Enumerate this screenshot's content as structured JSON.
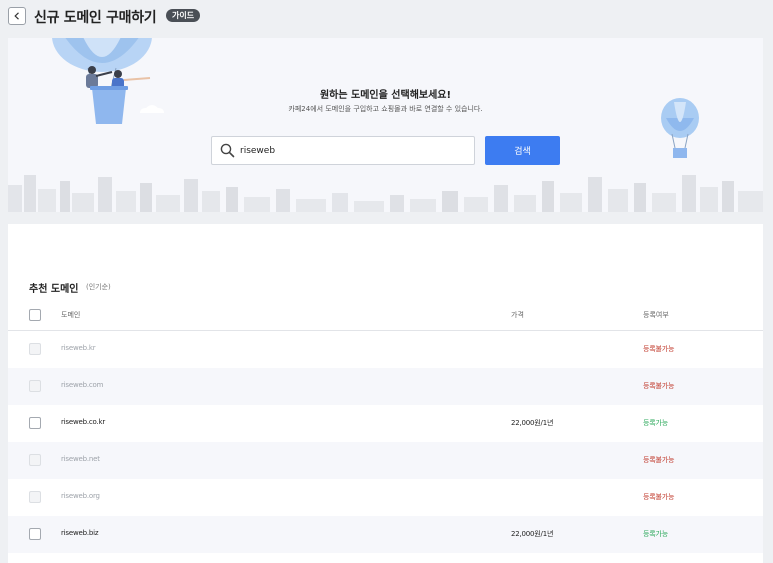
{
  "header": {
    "title": "신규 도메인 구매하기",
    "guide_badge": "가이드"
  },
  "hero": {
    "title": "원하는 도메인을 선택해보세요!",
    "subtitle": "카페24에서 도메인을 구입하고 쇼핑몰과 바로 연결할 수 있습니다.",
    "search": {
      "value": "riseweb",
      "placeholder": ""
    },
    "search_button": "검색"
  },
  "recommend": {
    "title": "추천 도메인",
    "subtitle": "(인기순)",
    "columns": {
      "domain": "도메인",
      "price": "가격",
      "status": "등록여부"
    },
    "rows": [
      {
        "domain": "riseweb.kr",
        "price": "",
        "status": "등록불가능",
        "available": false
      },
      {
        "domain": "riseweb.com",
        "price": "",
        "status": "등록불가능",
        "available": false
      },
      {
        "domain": "riseweb.co.kr",
        "price": "22,000원/1년",
        "status": "등록가능",
        "available": true
      },
      {
        "domain": "riseweb.net",
        "price": "",
        "status": "등록불가능",
        "available": false
      },
      {
        "domain": "riseweb.org",
        "price": "",
        "status": "등록불가능",
        "available": false
      },
      {
        "domain": "riseweb.biz",
        "price": "22,000원/1년",
        "status": "등록가능",
        "available": true
      }
    ]
  },
  "colors": {
    "accent": "#3d7cf1",
    "available": "#2eaa5c",
    "unavailable": "#c0392b"
  }
}
